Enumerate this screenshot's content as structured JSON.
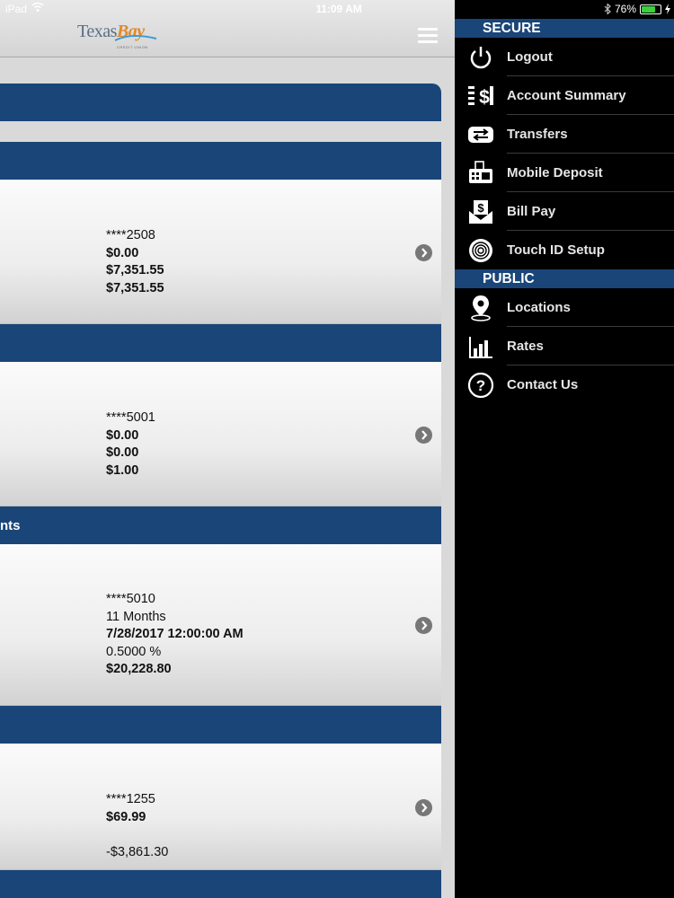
{
  "status_bar": {
    "device": "iPad",
    "time": "11:09 AM",
    "battery": "76%",
    "battery_level": 0.76
  },
  "header": {
    "logo_text_1": "Texas",
    "logo_text_2": "Bay",
    "logo_sub": "CREDIT UNION"
  },
  "sections": [
    {
      "heading": ""
    },
    {
      "heading": ""
    },
    {
      "heading": "nts"
    },
    {
      "heading": ""
    }
  ],
  "accounts": [
    {
      "number": "****2508",
      "line2": "$0.00",
      "line3": "$7,351.55",
      "line4": "$7,351.55"
    },
    {
      "number": "****5001",
      "line2": "$0.00",
      "line3": "$0.00",
      "line4": "$1.00"
    },
    {
      "number": "****5010",
      "line2": "11 Months",
      "line3": "7/28/2017 12:00:00 AM",
      "line4": "0.5000 %",
      "line5": "$20,228.80"
    },
    {
      "number": "****1255",
      "line2": "$69.99",
      "line3": "",
      "line4": "-$3,861.30"
    }
  ],
  "menu": {
    "secure_title": "SECURE",
    "secure_items": [
      {
        "label": "Logout",
        "icon": "power-icon"
      },
      {
        "label": "Account Summary",
        "icon": "dollar-list-icon"
      },
      {
        "label": "Transfers",
        "icon": "transfer-arrows-icon"
      },
      {
        "label": "Mobile Deposit",
        "icon": "check-scanner-icon"
      },
      {
        "label": "Bill Pay",
        "icon": "envelope-dollar-icon"
      },
      {
        "label": "Touch ID Setup",
        "icon": "fingerprint-icon"
      }
    ],
    "public_title": "PUBLIC",
    "public_items": [
      {
        "label": "Locations",
        "icon": "map-pin-icon"
      },
      {
        "label": "Rates",
        "icon": "bar-chart-icon"
      },
      {
        "label": "Contact Us",
        "icon": "question-icon"
      }
    ]
  },
  "colors": {
    "brand_blue": "#1a4578",
    "menu_bg": "#000000",
    "logo_orange": "#e08a2a"
  }
}
